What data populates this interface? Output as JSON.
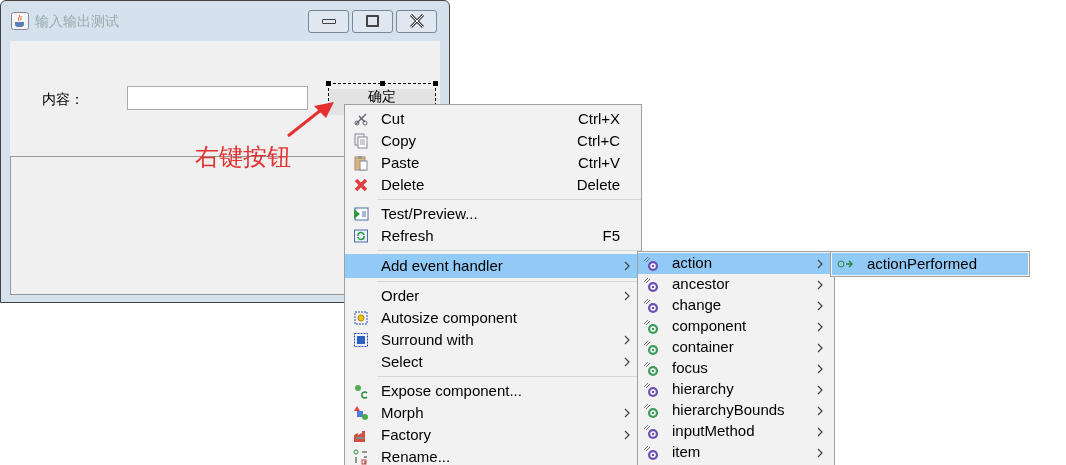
{
  "window": {
    "title": "输入输出测试",
    "label": "内容：",
    "button": "确定"
  },
  "annotation": {
    "text": "右键按钮"
  },
  "context_menu": {
    "groups": [
      [
        {
          "label": "Cut",
          "shortcut": "Ctrl+X",
          "kind": "cut",
          "selected": false,
          "submenu": false
        },
        {
          "label": "Copy",
          "shortcut": "Ctrl+C",
          "kind": "copy",
          "selected": false,
          "submenu": false
        },
        {
          "label": "Paste",
          "shortcut": "Ctrl+V",
          "kind": "paste",
          "selected": false,
          "submenu": false
        },
        {
          "label": "Delete",
          "shortcut": "Delete",
          "kind": "delete",
          "selected": false,
          "submenu": false
        }
      ],
      [
        {
          "label": "Test/Preview...",
          "kind": "test",
          "selected": false,
          "submenu": false
        },
        {
          "label": "Refresh",
          "shortcut": "F5",
          "kind": "refresh",
          "selected": false,
          "submenu": false
        }
      ],
      [
        {
          "label": "Add event handler",
          "kind": "none",
          "selected": true,
          "submenu": true
        }
      ],
      [
        {
          "label": "Order",
          "kind": "none",
          "selected": false,
          "submenu": true
        },
        {
          "label": "Autosize component",
          "kind": "autosize",
          "selected": false,
          "submenu": false
        },
        {
          "label": "Surround with",
          "kind": "surround",
          "selected": false,
          "submenu": true
        },
        {
          "label": "Select",
          "kind": "none",
          "selected": false,
          "submenu": true
        }
      ],
      [
        {
          "label": "Expose component...",
          "kind": "expose",
          "selected": false,
          "submenu": false
        },
        {
          "label": "Morph",
          "kind": "morph",
          "selected": false,
          "submenu": true
        },
        {
          "label": "Factory",
          "kind": "factory",
          "selected": false,
          "submenu": true
        },
        {
          "label": "Rename...",
          "kind": "rename",
          "selected": false,
          "submenu": false
        }
      ]
    ]
  },
  "event_menu": {
    "items": [
      {
        "label": "action",
        "kind": "interface",
        "selected": true
      },
      {
        "label": "ancestor",
        "kind": "interface",
        "selected": false
      },
      {
        "label": "change",
        "kind": "interface",
        "selected": false
      },
      {
        "label": "component",
        "kind": "class",
        "selected": false
      },
      {
        "label": "container",
        "kind": "class",
        "selected": false
      },
      {
        "label": "focus",
        "kind": "class",
        "selected": false
      },
      {
        "label": "hierarchy",
        "kind": "interface",
        "selected": false
      },
      {
        "label": "hierarchyBounds",
        "kind": "class",
        "selected": false
      },
      {
        "label": "inputMethod",
        "kind": "interface",
        "selected": false
      },
      {
        "label": "item",
        "kind": "interface",
        "selected": false
      }
    ]
  },
  "method_menu": {
    "items": [
      {
        "label": "actionPerformed",
        "selected": true
      }
    ]
  }
}
